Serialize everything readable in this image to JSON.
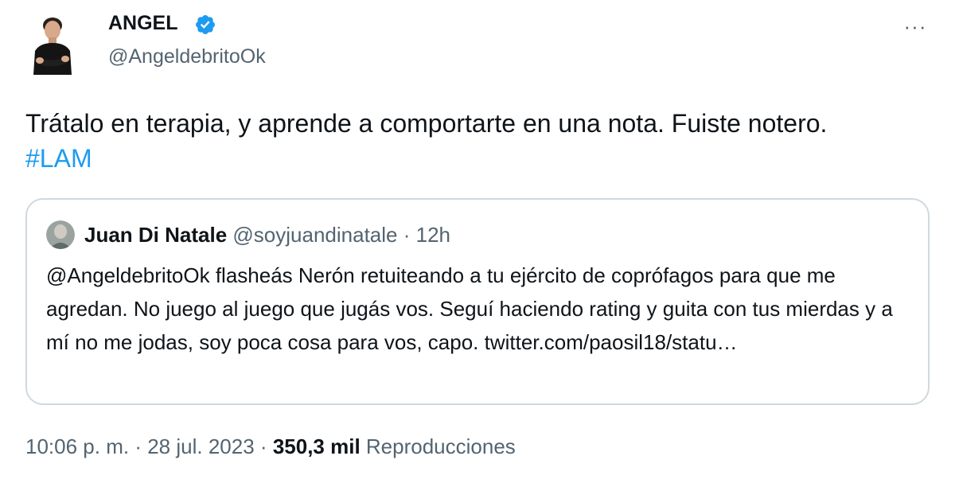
{
  "author": {
    "name": "ANGEL",
    "handle": "@AngeldebritoOk",
    "verified_color": "#1d9bf0"
  },
  "tweet": {
    "text": "Trátalo en terapia, y aprende a comportarte en una nota. Fuiste notero.",
    "hashtag": "#LAM"
  },
  "quoted_tweet": {
    "name": "Juan Di Natale",
    "handle": "@soyjuandinatale",
    "separator": "·",
    "time": "12h",
    "text": "@AngeldebritoOk flasheás Nerón retuiteando a tu ejército de coprófagos para que me agredan. No juego al juego que jugás vos. Seguí haciendo rating y guita con tus mierdas y a mí no me jodas, soy poca cosa para vos, capo. twitter.com/paosil18/statu…"
  },
  "meta": {
    "time": "10:06 p. m.",
    "sep1": "·",
    "date": "28 jul. 2023",
    "sep2": "·",
    "views_count": "350,3 mil",
    "views_label": "Reproducciones"
  },
  "menu": {
    "more_label": "···"
  },
  "colors": {
    "link": "#1d9bf0",
    "secondary_text": "#536471",
    "border": "#cfd9de"
  }
}
